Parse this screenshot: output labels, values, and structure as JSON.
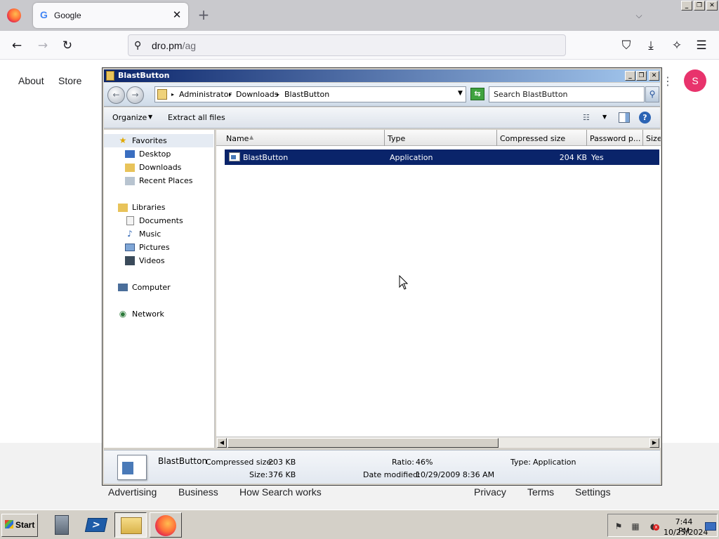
{
  "browser": {
    "tab_title": "Google",
    "tab_favicon": "G",
    "tab_close": "✕",
    "new_tab": "+",
    "tab_list": "⌵",
    "url_host": "dro.pm",
    "url_path": "/ag",
    "icons": {
      "firefox": "firefox-icon",
      "back": "←",
      "forward": "→",
      "reload": "↻",
      "search": "⚲",
      "pocket": "⛉",
      "download": "⤓",
      "extensions": "✧",
      "menu": "☰"
    },
    "window_controls": {
      "minimize": "_",
      "restore": "❐",
      "close": "✕"
    }
  },
  "google": {
    "top_left_links": [
      "About",
      "Store"
    ],
    "apps_icon": "⋮",
    "avatar_letter": "S",
    "avatar_color": "#e8336c",
    "footer_left": [
      "Advertising",
      "Business",
      "How Search works"
    ],
    "footer_right": [
      "Privacy",
      "Terms",
      "Settings"
    ]
  },
  "explorer": {
    "title": "BlastButton",
    "breadcrumb": [
      "Administrator",
      "Downloads",
      "BlastButton"
    ],
    "search_placeholder": "Search BlastButton",
    "toolbar": {
      "organize": "Organize",
      "extract_all": "Extract all files"
    },
    "nav": {
      "favorites": {
        "label": "Favorites",
        "items": [
          "Desktop",
          "Downloads",
          "Recent Places"
        ]
      },
      "libraries": {
        "label": "Libraries",
        "items": [
          "Documents",
          "Music",
          "Pictures",
          "Videos"
        ]
      },
      "computer": "Computer",
      "network": "Network"
    },
    "columns": [
      "Name",
      "Type",
      "Compressed size",
      "Password p...",
      "Size"
    ],
    "files": [
      {
        "name": "BlastButton",
        "type": "Application",
        "compressed_size": "204 KB",
        "password": "Yes"
      }
    ],
    "details": {
      "name": "BlastButton",
      "compressed_size_label": "Compressed size:",
      "compressed_size": "203 KB",
      "size_label": "Size:",
      "size": "376 KB",
      "ratio_label": "Ratio:",
      "ratio": "46%",
      "date_modified_label": "Date modified:",
      "date_modified": "10/29/2009 8:36 AM",
      "type_label": "Type:",
      "type": "Application"
    },
    "selection_color": "#0a246a"
  },
  "taskbar": {
    "start": "Start",
    "clock_time": "7:44 PM",
    "clock_date": "10/25/2024"
  }
}
